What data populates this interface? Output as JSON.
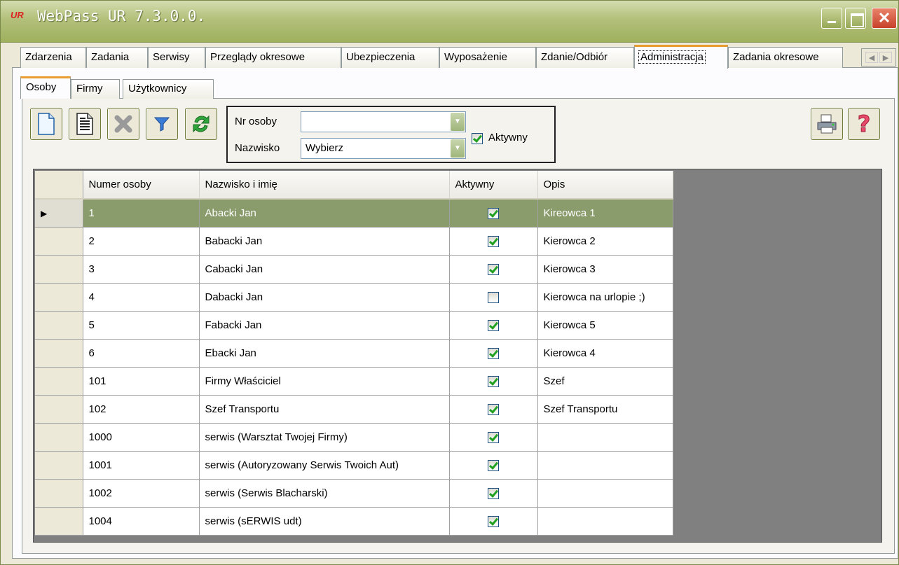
{
  "window": {
    "title": "WebPass UR 7.3.0.0.",
    "icon_text": "UR"
  },
  "main_tabs": [
    {
      "label": "Zdarzenia"
    },
    {
      "label": "Zadania"
    },
    {
      "label": "Serwisy"
    },
    {
      "label": "Przeglądy okresowe"
    },
    {
      "label": "Ubezpieczenia"
    },
    {
      "label": "Wyposażenie"
    },
    {
      "label": "Zdanie/Odbiór"
    },
    {
      "label": "Administracja",
      "active": true
    },
    {
      "label": "Zadania okresowe"
    }
  ],
  "sub_tabs": [
    {
      "label": "Osoby",
      "active": true
    },
    {
      "label": "Firmy"
    },
    {
      "label": "Użytkownicy"
    }
  ],
  "toolbar": {
    "buttons": [
      "new-icon",
      "edit-icon",
      "delete-icon",
      "filter-icon",
      "refresh-icon"
    ],
    "right_buttons": [
      "print-icon",
      "help-icon"
    ]
  },
  "filter": {
    "nr_osoby_label": "Nr osoby",
    "nr_osoby_value": "",
    "nazwisko_label": "Nazwisko",
    "nazwisko_value": "Wybierz",
    "aktywny_label": "Aktywny",
    "aktywny_checked": true
  },
  "grid": {
    "columns": [
      "Numer osoby",
      "Nazwisko i imię",
      "Aktywny",
      "Opis"
    ],
    "rows": [
      {
        "nr": "1",
        "name": "Abacki Jan",
        "active": true,
        "opis": "Kireowca 1",
        "selected": true
      },
      {
        "nr": "2",
        "name": "Babacki Jan",
        "active": true,
        "opis": "Kierowca 2"
      },
      {
        "nr": "3",
        "name": "Cabacki Jan",
        "active": true,
        "opis": "Kierowca 3"
      },
      {
        "nr": "4",
        "name": "Dabacki Jan",
        "active": false,
        "opis": "Kierowca na urlopie ;)"
      },
      {
        "nr": "5",
        "name": "Fabacki Jan",
        "active": true,
        "opis": "Kierowca 5"
      },
      {
        "nr": "6",
        "name": "Ebacki Jan",
        "active": true,
        "opis": "Kierowca 4"
      },
      {
        "nr": "101",
        "name": "Firmy Właściciel",
        "active": true,
        "opis": "Szef"
      },
      {
        "nr": "102",
        "name": "Szef Transportu",
        "active": true,
        "opis": "Szef Transportu"
      },
      {
        "nr": "1000",
        "name": "serwis (Warsztat Twojej Firmy)",
        "active": true,
        "opis": ""
      },
      {
        "nr": "1001",
        "name": "serwis (Autoryzowany Serwis Twoich Aut)",
        "active": true,
        "opis": ""
      },
      {
        "nr": "1002",
        "name": "serwis (Serwis Blacharski)",
        "active": true,
        "opis": ""
      },
      {
        "nr": "1004",
        "name": "serwis (sERWIS udt)",
        "active": true,
        "opis": ""
      }
    ]
  },
  "colors": {
    "selected_row": "#8a9c6c",
    "tab_accent": "#e89d31",
    "titlebar": "#b2c07a"
  }
}
